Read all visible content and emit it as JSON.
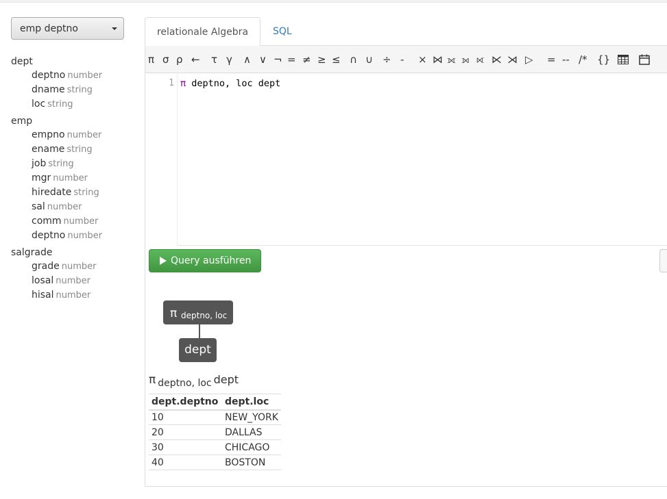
{
  "db_select": {
    "value": "emp deptno"
  },
  "schema": [
    {
      "table": "dept",
      "columns": [
        {
          "name": "deptno",
          "type": "number"
        },
        {
          "name": "dname",
          "type": "string"
        },
        {
          "name": "loc",
          "type": "string"
        }
      ]
    },
    {
      "table": "emp",
      "columns": [
        {
          "name": "empno",
          "type": "number"
        },
        {
          "name": "ename",
          "type": "string"
        },
        {
          "name": "job",
          "type": "string"
        },
        {
          "name": "mgr",
          "type": "number"
        },
        {
          "name": "hiredate",
          "type": "string"
        },
        {
          "name": "sal",
          "type": "number"
        },
        {
          "name": "comm",
          "type": "number"
        },
        {
          "name": "deptno",
          "type": "number"
        }
      ]
    },
    {
      "table": "salgrade",
      "columns": [
        {
          "name": "grade",
          "type": "number"
        },
        {
          "name": "losal",
          "type": "number"
        },
        {
          "name": "hisal",
          "type": "number"
        }
      ]
    }
  ],
  "tabs": {
    "algebra": "relationale Algebra",
    "sql": "SQL"
  },
  "toolbar": [
    {
      "sym": "π",
      "name": "projection"
    },
    {
      "sym": "σ",
      "name": "selection"
    },
    {
      "sym": "ρ",
      "name": "rename"
    },
    {
      "sym": "←",
      "name": "assignment"
    },
    {
      "sym": "τ",
      "name": "orderby"
    },
    {
      "sym": "γ",
      "name": "groupby"
    },
    {
      "sym": "∧",
      "name": "and"
    },
    {
      "sym": "∨",
      "name": "or"
    },
    {
      "sym": "¬",
      "name": "not"
    },
    {
      "sym": "=",
      "name": "equals"
    },
    {
      "sym": "≠",
      "name": "not-equals"
    },
    {
      "sym": "≥",
      "name": "greater-equal"
    },
    {
      "sym": "≤",
      "name": "less-equal"
    },
    {
      "sym": "∩",
      "name": "intersect"
    },
    {
      "sym": "∪",
      "name": "union"
    },
    {
      "sym": "÷",
      "name": "division"
    },
    {
      "sym": "-",
      "name": "difference"
    },
    {
      "sym": "×",
      "name": "cross-product"
    },
    {
      "sym": "⋈",
      "name": "natural-join"
    },
    {
      "sym": "⟗",
      "name": "full-outer-join"
    },
    {
      "sym": "⟕",
      "name": "left-outer-join"
    },
    {
      "sym": "⟖",
      "name": "right-outer-join"
    },
    {
      "sym": "⋉",
      "name": "left-semi-join"
    },
    {
      "sym": "⋊",
      "name": "right-semi-join"
    },
    {
      "sym": "▷",
      "name": "anti-join"
    },
    {
      "sym": "=",
      "name": "assign-equals"
    },
    {
      "sym": "--",
      "name": "comment"
    },
    {
      "sym": "/*",
      "name": "block-comment"
    },
    {
      "sym": "{}",
      "name": "inline-relation"
    },
    {
      "sym": "table",
      "name": "table-icon"
    },
    {
      "sym": "calendar",
      "name": "calendar-icon"
    }
  ],
  "editor": {
    "line_number": "1",
    "operator": "π",
    "rest": " deptno, loc dept"
  },
  "run_button": "Query ausführen",
  "tree": {
    "root_symbol": "π",
    "root_sub": "deptno, loc",
    "child": "dept"
  },
  "result": {
    "title_symbol": "π",
    "title_sub": "deptno, loc",
    "title_relation": "dept",
    "columns": [
      "dept.deptno",
      "dept.loc"
    ],
    "rows": [
      [
        "10",
        "NEW_YORK"
      ],
      [
        "20",
        "DALLAS"
      ],
      [
        "30",
        "CHICAGO"
      ],
      [
        "40",
        "BOSTON"
      ]
    ]
  }
}
